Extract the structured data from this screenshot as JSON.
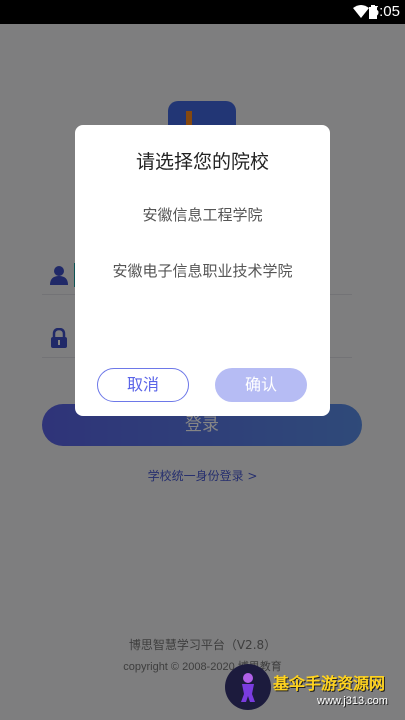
{
  "status_bar": {
    "time": "5:05"
  },
  "login": {
    "submit_label": "登录",
    "sso_link": "学校统一身份登录 >"
  },
  "footer": {
    "platform": "博思智慧学习平台（V2.8）",
    "copyright": "copyright © 2008-2020 博思教育"
  },
  "dialog": {
    "title": "请选择您的院校",
    "schools": [
      "安徽信息工程学院",
      "安徽电子信息职业技术学院"
    ],
    "cancel_label": "取消",
    "confirm_label": "确认"
  },
  "watermark": {
    "title": "基伞手游资源网",
    "url": "www.j313.com"
  },
  "colors": {
    "accent": "#5a64e8",
    "confirm_disabled": "#b6bcf4",
    "watermark_text": "#ffd31f"
  }
}
